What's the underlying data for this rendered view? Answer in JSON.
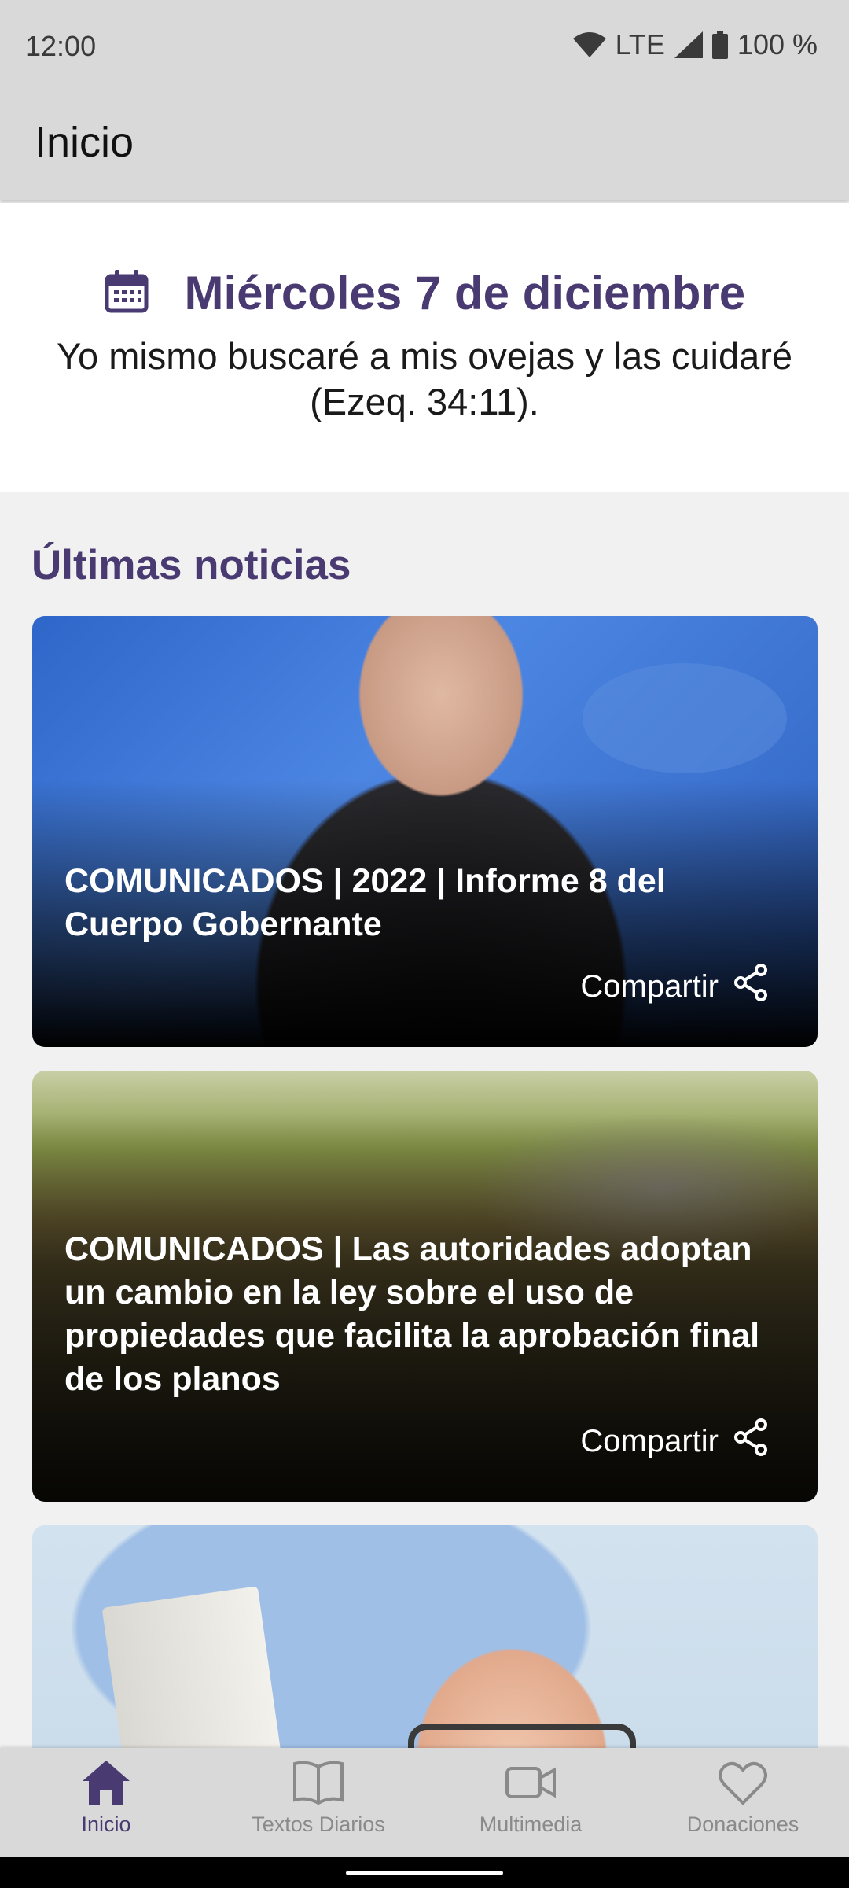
{
  "status_bar": {
    "time": "12:00",
    "network": "LTE",
    "battery": "100 %"
  },
  "app_bar": {
    "title": "Inicio"
  },
  "daily_text": {
    "date": "Miércoles 7 de diciembre",
    "text": "Yo mismo buscaré a mis ovejas y las cuidaré (Ezeq. 34:11)."
  },
  "news": {
    "section_title": "Últimas noticias",
    "items": [
      {
        "title": "COMUNICADOS | 2022 | Informe 8 del Cuerpo Gobernante",
        "share_label": "Compartir"
      },
      {
        "title": "COMUNICADOS | Las autoridades adoptan un cambio en la ley sobre el uso de propiedades que facilita la aprobación final de los planos",
        "share_label": "Compartir"
      }
    ]
  },
  "bottom_nav": {
    "items": [
      {
        "label": "Inicio",
        "icon": "home-icon",
        "active": true
      },
      {
        "label": "Textos Diarios",
        "icon": "book-icon",
        "active": false
      },
      {
        "label": "Multimedia",
        "icon": "video-icon",
        "active": false
      },
      {
        "label": "Donaciones",
        "icon": "heart-icon",
        "active": false
      }
    ]
  },
  "colors": {
    "accent": "#4a3a72",
    "bar_bg": "#d9d9d9",
    "inactive": "#8a8a8a"
  }
}
